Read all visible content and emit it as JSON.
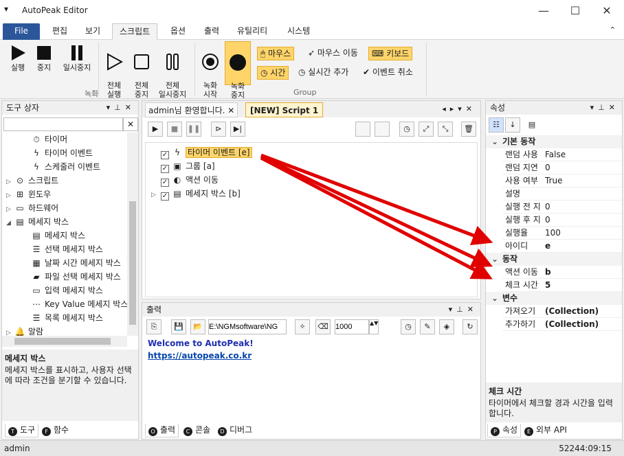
{
  "window": {
    "title": "AutoPeak Editor"
  },
  "menu_tabs": [
    "File",
    "편집",
    "보기",
    "스크립트",
    "옵션",
    "출력",
    "유틸리티",
    "시스템"
  ],
  "ribbon": {
    "record": {
      "run": "실행",
      "stop": "중지",
      "pause": "일시중지",
      "run_all": "전체\n실행",
      "stop_all": "전체\n중지",
      "pause_all": "전체\n일시중지",
      "group_label": "녹화"
    },
    "rec": {
      "start": "녹화\n시작",
      "stop": "녹화\n중지"
    },
    "group": {
      "mouse": "마우스",
      "mouse_move": "마우스 이동",
      "keyboard": "키보드",
      "time": "시간",
      "realtime_add": "실시간 추가",
      "event_cancel": "이벤트 취소",
      "label": "Group"
    }
  },
  "toolbox": {
    "title": "도구 상자",
    "search_value": "",
    "items": [
      {
        "label": "타이머",
        "icon": "timer-icon",
        "indent": 2
      },
      {
        "label": "타이머 이벤트",
        "icon": "bolt-icon",
        "indent": 2
      },
      {
        "label": "스케줄러 이벤트",
        "icon": "bolt-icon",
        "indent": 2
      },
      {
        "label": "스크립트",
        "icon": "script-icon",
        "indent": 1,
        "expander": "▷"
      },
      {
        "label": "윈도우",
        "icon": "windows-icon",
        "indent": 1,
        "expander": "▷"
      },
      {
        "label": "하드웨어",
        "icon": "computer-icon",
        "indent": 1,
        "expander": "▷"
      },
      {
        "label": "메세지 박스",
        "icon": "message-icon",
        "indent": 1,
        "expander": "◢"
      },
      {
        "label": "메세지 박스",
        "icon": "message-icon",
        "indent": 2
      },
      {
        "label": "선택 메세지 박스",
        "icon": "list-icon",
        "indent": 2
      },
      {
        "label": "날짜 시간 메세지 박스",
        "icon": "calendar-icon",
        "indent": 2
      },
      {
        "label": "파일 선택 메세지 박스",
        "icon": "folder-icon",
        "indent": 2
      },
      {
        "label": "입력 메세지 박스",
        "icon": "input-icon",
        "indent": 2
      },
      {
        "label": "Key Value 메세지 박스",
        "icon": "dots-icon",
        "indent": 2
      },
      {
        "label": "목록 메세지 박스",
        "icon": "list-icon",
        "indent": 2
      },
      {
        "label": "알람",
        "icon": "bell-icon",
        "indent": 1,
        "expander": "▷"
      }
    ],
    "desc_title": "메세지 박스",
    "desc_text": "메세지 박스를 표시하고, 사용자 선택에 따라 조건을 분기할 수 있습니다.",
    "tabs": [
      {
        "badge": "T",
        "label": "도구"
      },
      {
        "badge": "F",
        "label": "함수"
      }
    ]
  },
  "editor": {
    "tabs": [
      "admin님 환영합니다.",
      "[NEW] Script 1"
    ],
    "tree": [
      {
        "label": "타이머 이벤트 [e]",
        "icon": "bolt-icon",
        "selected": true
      },
      {
        "label": "그룹 [a]",
        "icon": "group-icon"
      },
      {
        "label": "액션 이동",
        "icon": "action-icon"
      },
      {
        "label": "메세지 박스 [b]",
        "icon": "message-icon",
        "expander": "▷"
      }
    ]
  },
  "output": {
    "title": "출력",
    "path_value": "E:\\NGMsoftware\\NG",
    "interval_value": "1000",
    "lines": [
      "Welcome to AutoPeak!",
      "https://autopeak.co.kr"
    ],
    "tabs": [
      {
        "badge": "O",
        "label": "출력"
      },
      {
        "badge": "C",
        "label": "콘솔"
      },
      {
        "badge": "D",
        "label": "디버그"
      }
    ]
  },
  "properties": {
    "title": "속성",
    "categories": [
      {
        "name": "기본 동작",
        "rows": [
          {
            "k": "랜덤 사용",
            "v": "False"
          },
          {
            "k": "랜덤 지연",
            "v": "0"
          },
          {
            "k": "사용 여부",
            "v": "True"
          },
          {
            "k": "설명",
            "v": ""
          },
          {
            "k": "실행 전 지",
            "v": "0"
          },
          {
            "k": "실행 후 지",
            "v": "0"
          },
          {
            "k": "실행율",
            "v": "100"
          },
          {
            "k": "아이디",
            "v": "e",
            "bold": true
          }
        ]
      },
      {
        "name": "동작",
        "rows": [
          {
            "k": "액션 이동",
            "v": "b",
            "bold": true
          },
          {
            "k": "체크 시간",
            "v": "5",
            "bold": true
          }
        ]
      },
      {
        "name": "변수",
        "rows": [
          {
            "k": "가져오기",
            "v": "(Collection)",
            "bold": true
          },
          {
            "k": "추가하기",
            "v": "(Collection)",
            "bold": true
          }
        ]
      }
    ],
    "desc_title": "체크 시간",
    "desc_text": "타이머에서 체크할 경과 시간을 입력합니다.",
    "tabs": [
      {
        "badge": "P",
        "label": "속성"
      },
      {
        "badge": "E",
        "label": "외부 API"
      }
    ]
  },
  "status": {
    "user": "admin",
    "time": "52244:09:15"
  },
  "colors": {
    "accent": "#2b579a",
    "highlight": "#ffd56a",
    "arrow": "#e00000",
    "link": "#0645ad"
  }
}
